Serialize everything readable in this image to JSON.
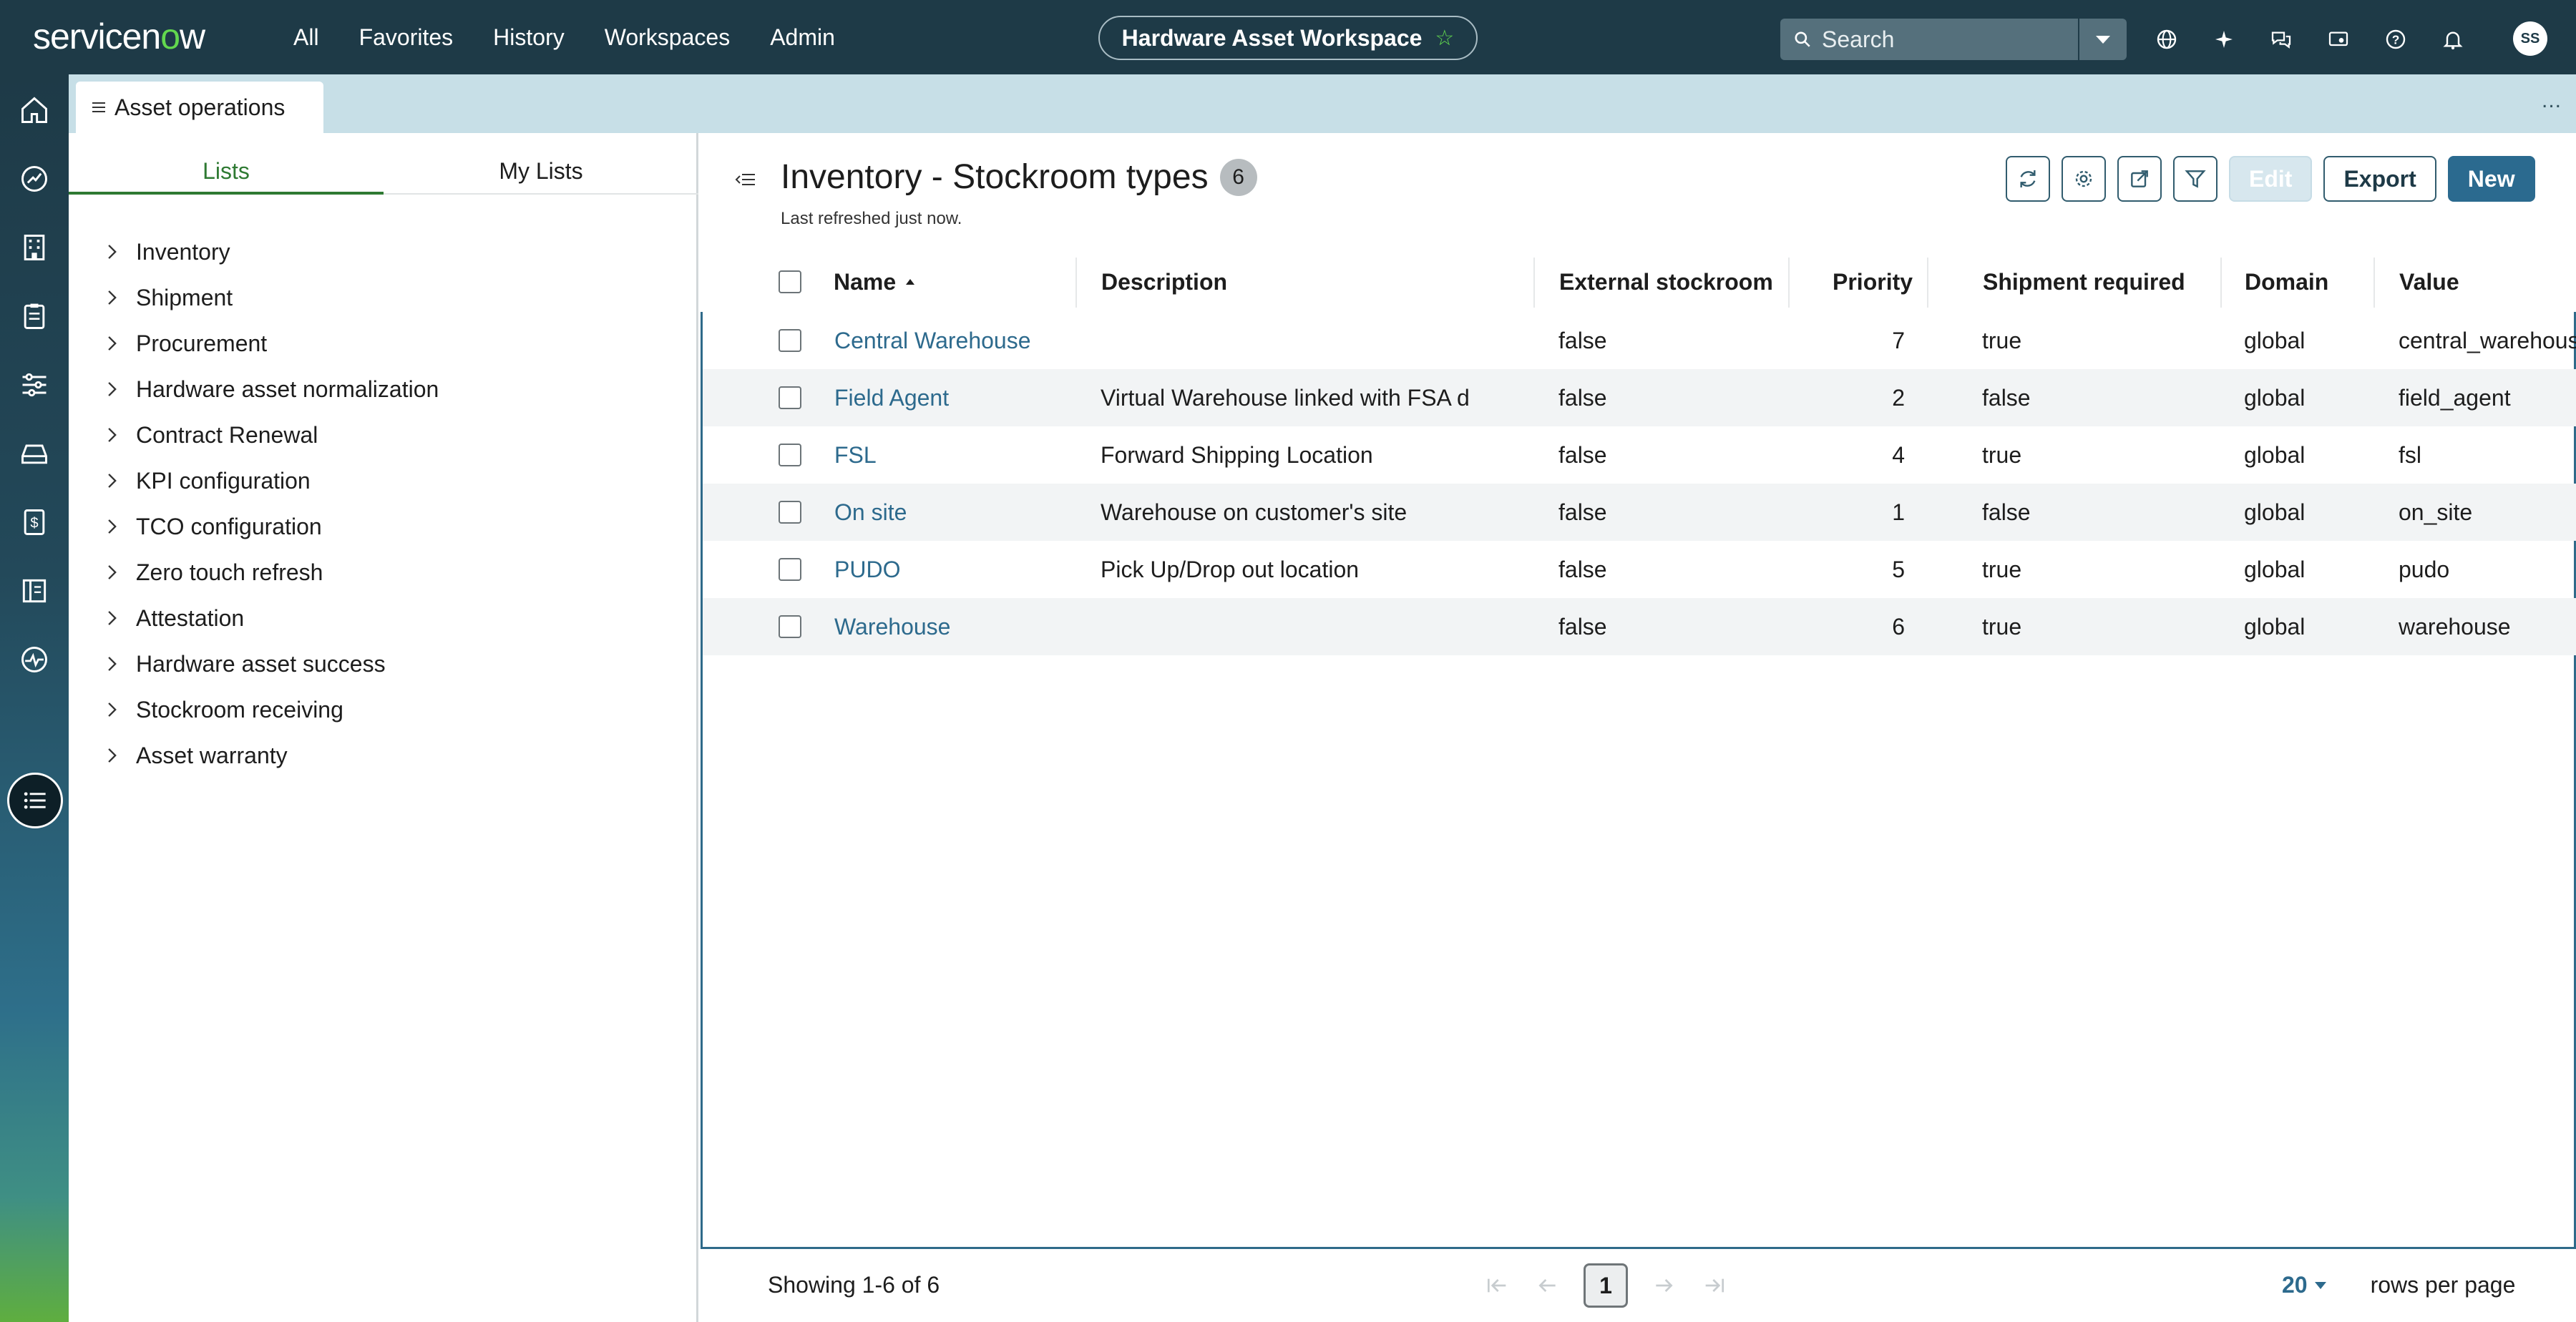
{
  "topnav": {
    "logo_prefix": "servicen",
    "logo_o": "o",
    "logo_suffix": "w",
    "links": [
      "All",
      "Favorites",
      "History",
      "Workspaces",
      "Admin"
    ],
    "workspace": "Hardware Asset Workspace",
    "search_placeholder": "Search",
    "avatar_initials": "SS"
  },
  "tabstrip": {
    "tab_label": "Asset operations",
    "more": "..."
  },
  "leftpanel": {
    "tabs": [
      "Lists",
      "My Lists"
    ],
    "active_tab": "Lists",
    "tree": [
      "Inventory",
      "Shipment",
      "Procurement",
      "Hardware asset normalization",
      "Contract Renewal",
      "KPI configuration",
      "TCO configuration",
      "Zero touch refresh",
      "Attestation",
      "Hardware asset success",
      "Stockroom receiving",
      "Asset warranty"
    ]
  },
  "main": {
    "title": "Inventory - Stockroom types",
    "count": "6",
    "subtitle": "Last refreshed just now.",
    "buttons": {
      "edit": "Edit",
      "export": "Export",
      "new": "New"
    },
    "columns": [
      "Name",
      "Description",
      "External stockroom",
      "Priority",
      "Shipment required",
      "Domain",
      "Value"
    ],
    "sort_column": "Name",
    "rows": [
      {
        "name": "Central Warehouse",
        "description": "",
        "external": "false",
        "priority": "7",
        "shipment": "true",
        "domain": "global",
        "value": "central_warehouse"
      },
      {
        "name": "Field Agent",
        "description": "Virtual Warehouse linked with FSA direct",
        "external": "false",
        "priority": "2",
        "shipment": "false",
        "domain": "global",
        "value": "field_agent"
      },
      {
        "name": "FSL",
        "description": "Forward Shipping Location",
        "external": "false",
        "priority": "4",
        "shipment": "true",
        "domain": "global",
        "value": "fsl"
      },
      {
        "name": "On site",
        "description": "Warehouse on customer's site",
        "external": "false",
        "priority": "1",
        "shipment": "false",
        "domain": "global",
        "value": "on_site"
      },
      {
        "name": "PUDO",
        "description": "Pick Up/Drop out location",
        "external": "false",
        "priority": "5",
        "shipment": "true",
        "domain": "global",
        "value": "pudo"
      },
      {
        "name": "Warehouse",
        "description": "",
        "external": "false",
        "priority": "6",
        "shipment": "true",
        "domain": "global",
        "value": "warehouse"
      }
    ],
    "footer": {
      "showing": "Showing 1-6 of 6",
      "current_page": "1",
      "rows_per_page_value": "20",
      "rows_per_page_label": "rows per page"
    }
  },
  "colors": {
    "nav_bg": "#1e3a47",
    "accent_green": "#62d84e",
    "link_blue": "#2d6a8d",
    "primary_button": "#2b6a8f"
  }
}
